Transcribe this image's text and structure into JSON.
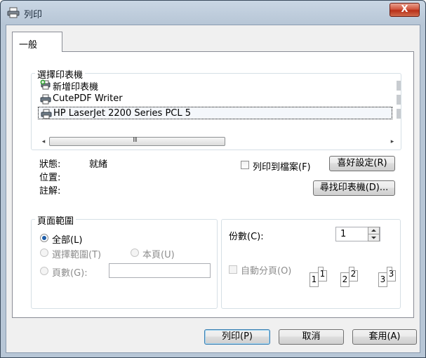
{
  "window": {
    "title": "列印",
    "close_glyph": "X",
    "accent": "#c8462c"
  },
  "tabs": [
    {
      "label": "一般",
      "selected": true
    }
  ],
  "printers": {
    "group_label": "選擇印表機",
    "items": [
      {
        "name": "新增印表機",
        "icon": "add-printer-icon",
        "selected": false
      },
      {
        "name": "CutePDF Writer",
        "icon": "printer-icon",
        "selected": false
      },
      {
        "name": "HP LaserJet 2200 Series PCL 5",
        "icon": "printer-icon",
        "selected": true
      }
    ],
    "scroll_left": "◂",
    "scroll_right": "▸",
    "scroll_grip": "III"
  },
  "status": {
    "status_label": "狀態:",
    "status_value": "就緒",
    "location_label": "位置:",
    "comment_label": "註解:",
    "print_to_file_label": "列印到檔案(F)",
    "print_to_file_checked": false,
    "preferences_button": "喜好設定(R)",
    "find_printer_button": "尋找印表機(D)..."
  },
  "page_range": {
    "group_label": "頁面範圍",
    "all_label": "全部(L)",
    "selection_label": "選擇範圍(T)",
    "current_page_label": "本頁(U)",
    "pages_label": "頁數(G):",
    "pages_value": "",
    "selected": "all"
  },
  "copies": {
    "copies_label": "份數(C):",
    "copies_value": "1",
    "collate_label": "自動分頁(O)",
    "collate_checked": false,
    "collate_pages": [
      "1",
      "1",
      "2",
      "2",
      "3",
      "3"
    ]
  },
  "buttons": {
    "print": "列印(P)",
    "cancel": "取消",
    "apply": "套用(A)"
  }
}
